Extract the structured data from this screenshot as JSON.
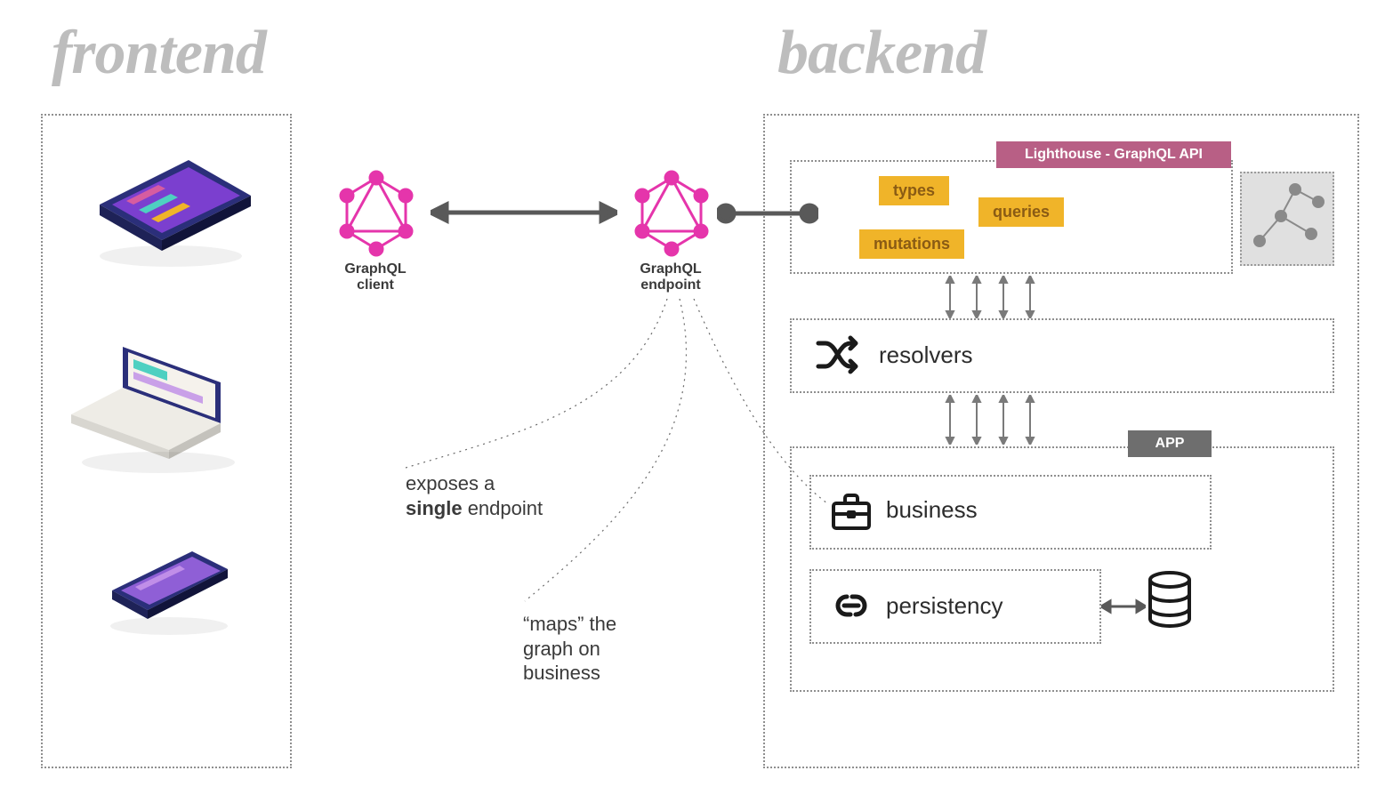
{
  "headings": {
    "frontend": "frontend",
    "backend": "backend"
  },
  "graphql": {
    "client_label_1": "GraphQL",
    "client_label_2": "client",
    "endpoint_label_1": "GraphQL",
    "endpoint_label_2": "endpoint"
  },
  "annotations": {
    "exposes_line1": "exposes a",
    "exposes_bold": "single",
    "exposes_line2": " endpoint",
    "maps_line1": "“maps” the",
    "maps_line2": "graph on",
    "maps_line3": "business"
  },
  "tags": {
    "lighthouse": "Lighthouse - GraphQL API",
    "types": "types",
    "queries": "queries",
    "mutations": "mutations",
    "app": "APP"
  },
  "layers": {
    "resolvers": "resolvers",
    "business": "business",
    "persistency": "persistency"
  },
  "colors": {
    "graphql_pink": "#e535ab",
    "tag_yellow_bg": "#f0b429",
    "tag_pink_bg": "#b85f85",
    "tag_gray_bg": "#6e6e6e",
    "dotted_border": "#8f8f8f",
    "heading_gray": "#bdbdbd"
  }
}
